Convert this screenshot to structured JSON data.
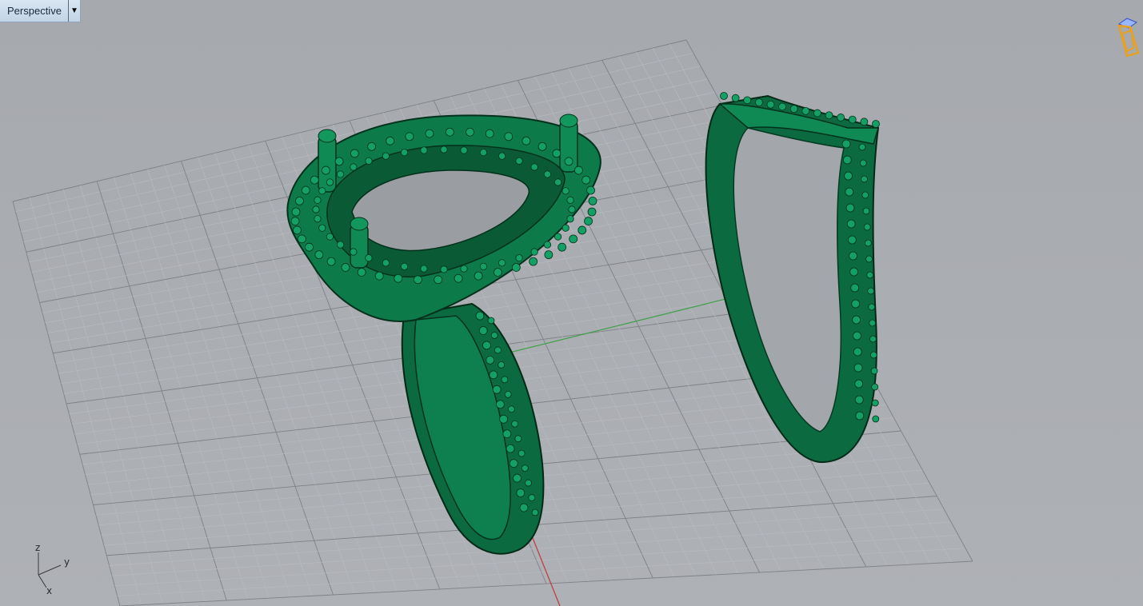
{
  "viewport": {
    "title": "Perspective",
    "dropdown_icon": "triangle-down-icon"
  },
  "axes": {
    "z": "z",
    "y": "y",
    "x": "x"
  },
  "colors": {
    "background": "#a9acb1",
    "grid_minor": "#b9bcc1",
    "grid_major": "#7e8185",
    "x_axis": "#c04040",
    "y_axis": "#3fa048",
    "model": "#0e7e4e",
    "model_edge": "#043a20"
  },
  "icons": {
    "navigation_cube": "view-cube-icon"
  }
}
